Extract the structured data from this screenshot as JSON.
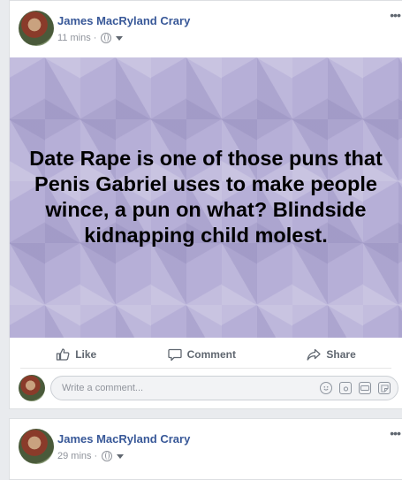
{
  "post1": {
    "author": "James MacRyland Crary",
    "time": "11 mins",
    "separator": "·",
    "more": "•••",
    "quote": "Date Rape is one of those puns that Penis Gabriel uses to make people wince, a pun on what? Blindside kidnapping child molest.",
    "background_color": "#b6afd7",
    "actions": {
      "like": "Like",
      "comment": "Comment",
      "share": "Share"
    },
    "comment_placeholder": "Write a comment...",
    "comment_icons": [
      "emoji-icon",
      "camera-icon",
      "gif-icon",
      "sticker-icon"
    ]
  },
  "post2": {
    "author": "James MacRyland Crary",
    "time": "29 mins",
    "separator": "·",
    "more": "•••"
  },
  "colors": {
    "author_blue": "#385898",
    "meta_gray": "#90949c",
    "feed_bg": "#e9ebee"
  }
}
